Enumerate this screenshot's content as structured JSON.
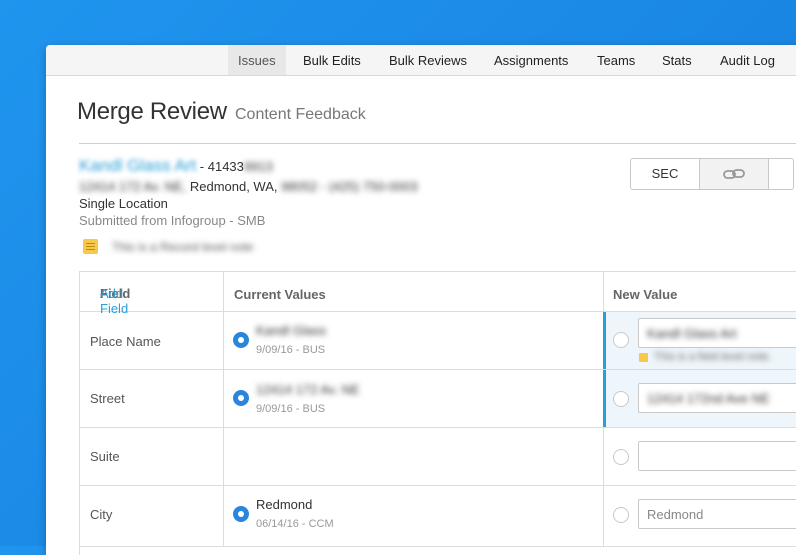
{
  "nav": {
    "items": [
      {
        "label": "Issues",
        "active": true
      },
      {
        "label": "Bulk Edits"
      },
      {
        "label": "Bulk Reviews"
      },
      {
        "label": "Assignments"
      },
      {
        "label": "Teams"
      },
      {
        "label": "Stats"
      },
      {
        "label": "Audit Log"
      }
    ]
  },
  "header": {
    "title": "Merge Review",
    "subtitle": "Content Feedback"
  },
  "business": {
    "name": "Kandl Glass Art",
    "id_prefix": "- 41433",
    "id_suffix": "9913",
    "street_blur": "12414 172 Av. NE,",
    "city_state": "Redmond, WA,",
    "zip_phone_blur": "98052 - (425) 750-0003",
    "location_type": "Single Location",
    "submitted": "Submitted from Infogroup - SMB",
    "record_note": "This is a Record level note"
  },
  "actions": {
    "sec_label": "SEC",
    "link_icon": "link-icon"
  },
  "table": {
    "headers": {
      "field": "Field",
      "dash": "-",
      "add_field": "Add Field",
      "current": "Current Values",
      "new": "New Value"
    },
    "rows": [
      {
        "field": "Place Name",
        "current_value": "Kandl Glass",
        "current_meta": "9/09/16 - BUS",
        "new_value": "Kandl Glass Art",
        "new_note": "This is a field level note."
      },
      {
        "field": "Street",
        "current_value": "12414 172 Av. NE",
        "current_meta": "9/09/16 - BUS",
        "new_value": "12414 172nd Ave NE"
      },
      {
        "field": "Suite",
        "current_value": "",
        "current_meta": "",
        "new_value": ""
      },
      {
        "field": "City",
        "current_value": "Redmond",
        "current_meta": "06/14/16 - CCM",
        "new_placeholder": "Redmond"
      }
    ]
  },
  "colors": {
    "accent": "#2a9fd6",
    "radio": "#2a86dd",
    "background": "#1a86e4",
    "note": "#f7c84a"
  }
}
